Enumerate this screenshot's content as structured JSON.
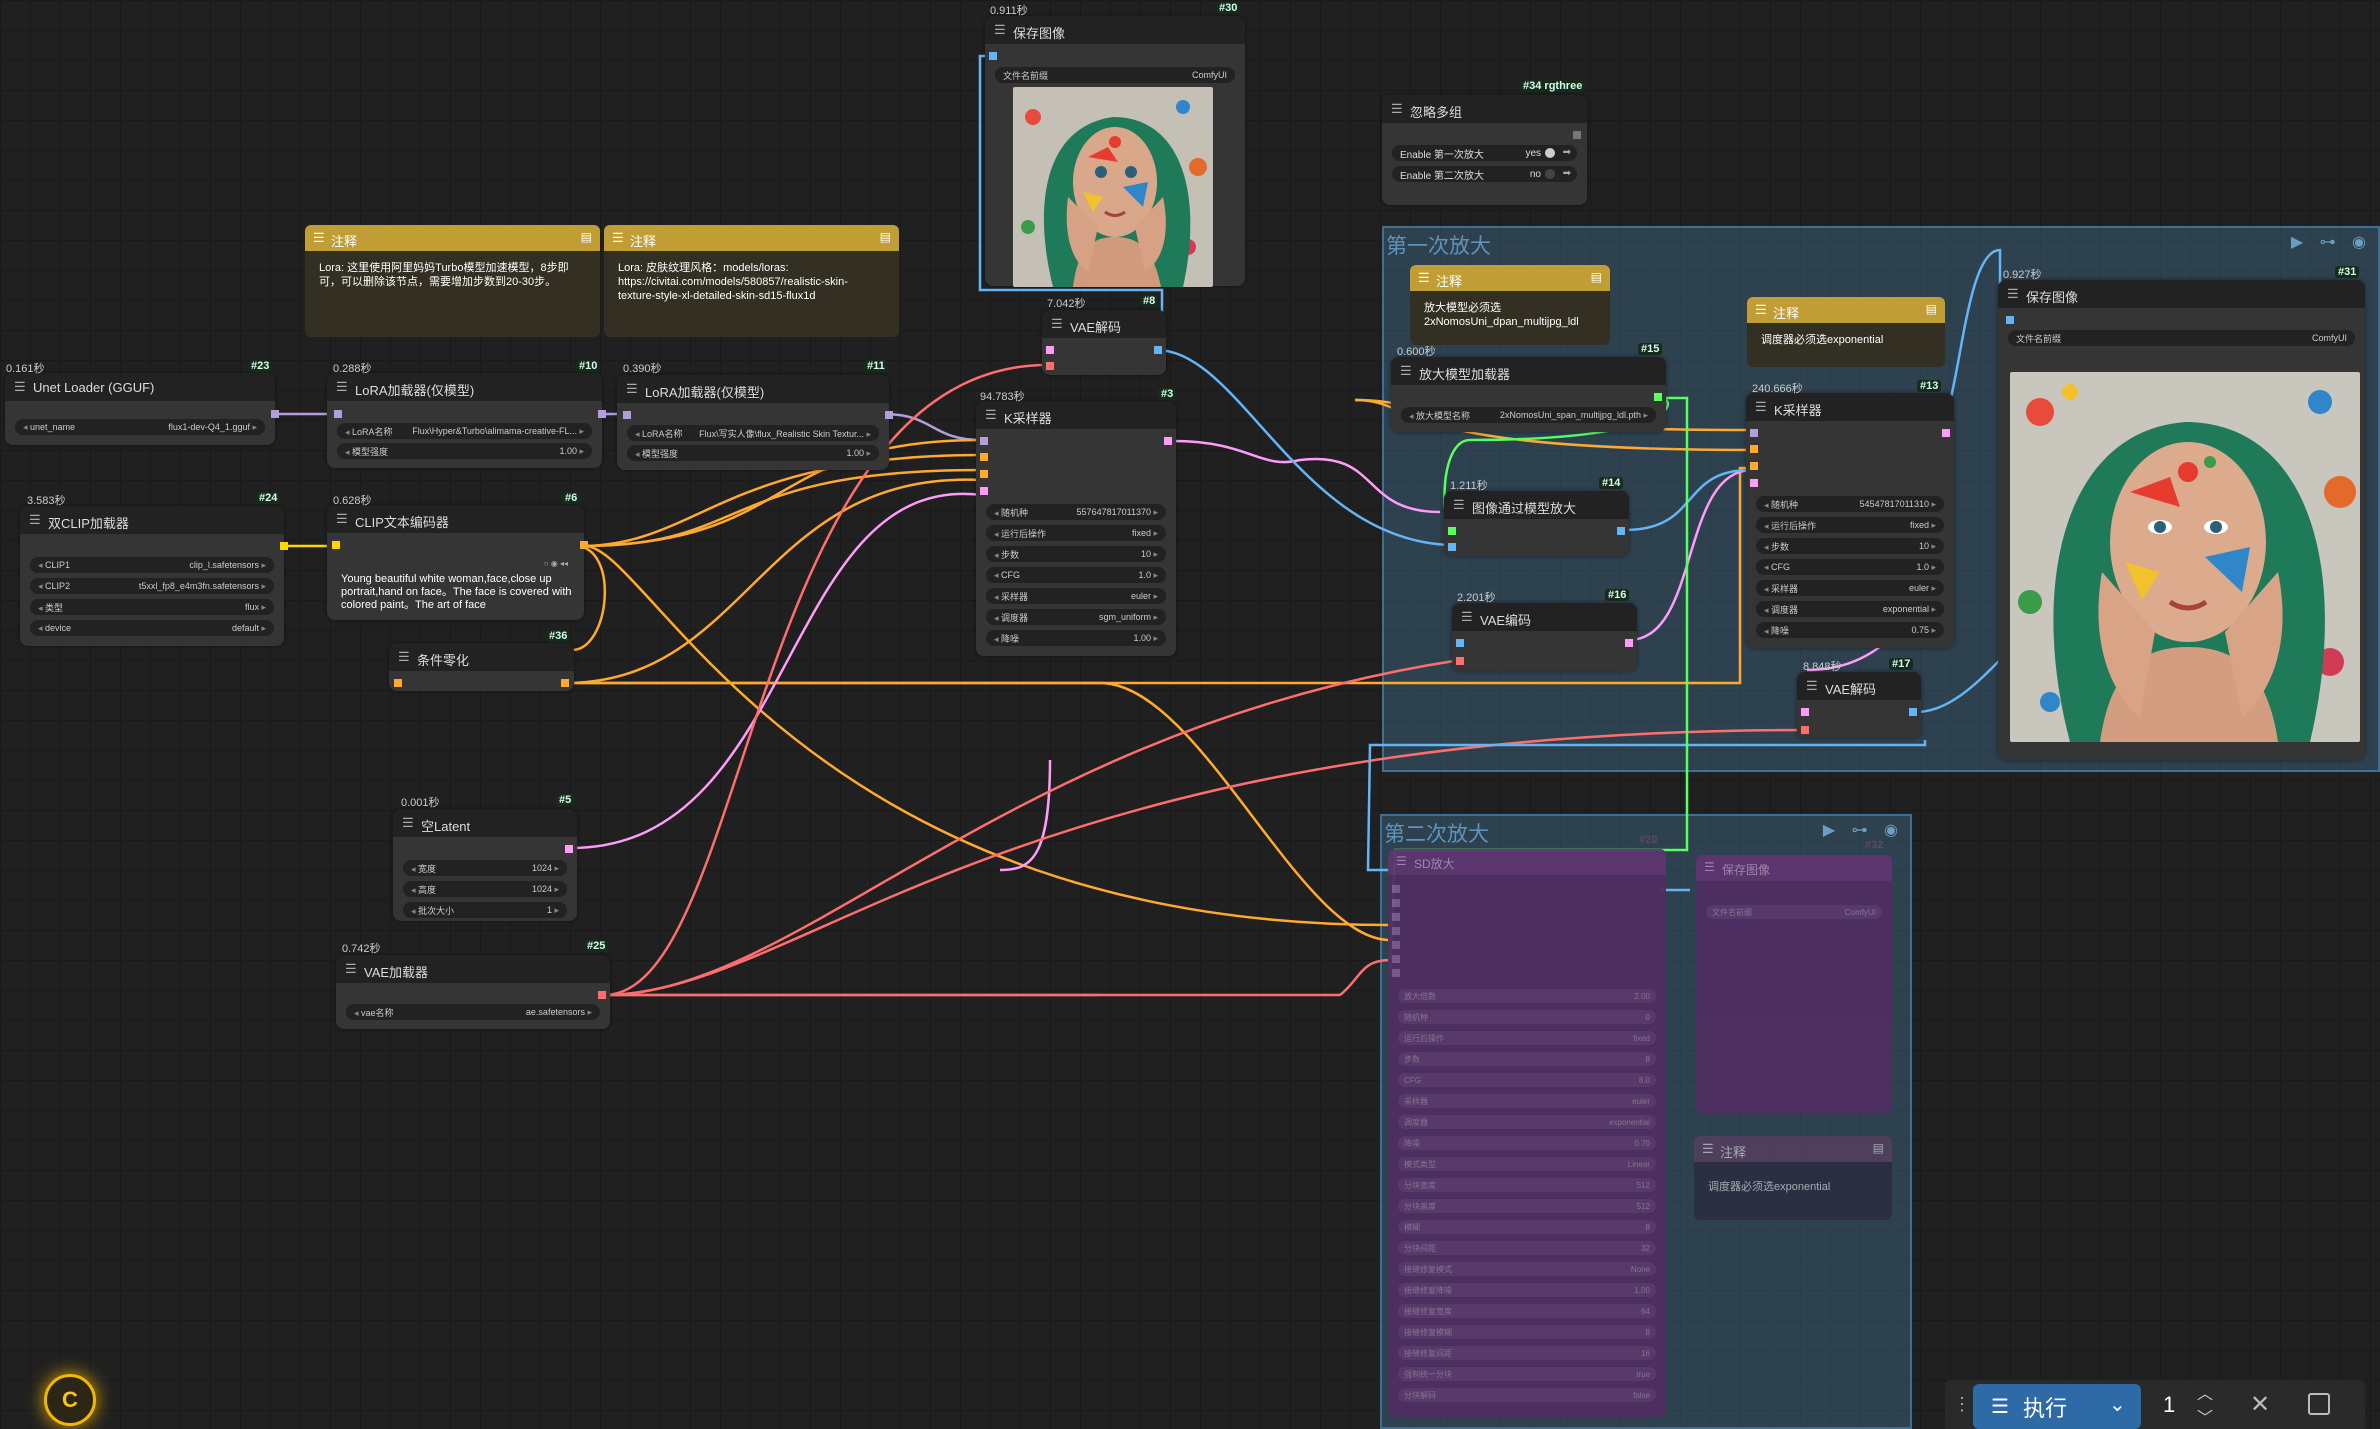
{
  "groups": {
    "g1": {
      "title": "第一次放大"
    },
    "g2": {
      "title": "第二次放大"
    }
  },
  "notes": {
    "n1": {
      "title": "注释",
      "text": "Lora: 这里使用阿里妈妈Turbo模型加速模型，8步即可，可以删除该节点，需要增加步数到20-30步。"
    },
    "n2": {
      "title": "注释",
      "text": "Lora: 皮肤纹理风格：models/loras:\nhttps://civitai.com/models/580857/realistic-skin-texture-style-xl-detailed-skin-sd15-flux1d"
    },
    "n3": {
      "title": "注释",
      "text": "放大模型必须选\n2xNomosUni_dpan_multijpg_ldl"
    },
    "n4": {
      "title": "注释",
      "text": "调度器必须选exponential"
    },
    "n5": {
      "title": "注释",
      "text": "调度器必须选exponential"
    }
  },
  "nodes": {
    "unet": {
      "title": "Unet Loader (GGUF)",
      "time": "0.161秒",
      "id": "#23",
      "widgets": [
        {
          "label": "unet_name",
          "value": "flux1-dev-Q4_1.gguf"
        }
      ]
    },
    "lora1": {
      "title": "LoRA加载器(仅模型)",
      "time": "0.288秒",
      "id": "#10",
      "widgets": [
        {
          "label": "LoRA名称",
          "value": "Flux\\Hyper&Turbo\\alimama-creative-FL..."
        },
        {
          "label": "模型强度",
          "value": "1.00"
        }
      ]
    },
    "lora2": {
      "title": "LoRA加载器(仅模型)",
      "time": "0.390秒",
      "id": "#11",
      "widgets": [
        {
          "label": "LoRA名称",
          "value": "Flux\\写实人像\\flux_Realistic Skin Textur..."
        },
        {
          "label": "模型强度",
          "value": "1.00"
        }
      ]
    },
    "dclip": {
      "title": "双CLIP加载器",
      "time": "3.583秒",
      "id": "#24",
      "widgets": [
        {
          "label": "CLIP1",
          "value": "clip_l.safetensors"
        },
        {
          "label": "CLIP2",
          "value": "t5xxl_fp8_e4m3fn.safetensors"
        },
        {
          "label": "类型",
          "value": "flux"
        },
        {
          "label": "device",
          "value": "default"
        }
      ]
    },
    "clipenc": {
      "title": "CLIP文本编码器",
      "time": "0.628秒",
      "id": "#6",
      "text": "Young beautiful white woman,face,close up portrait,hand on face。The face is covered with colored paint。The art of face"
    },
    "zero": {
      "title": "条件零化",
      "id": "#36"
    },
    "latent": {
      "title": "空Latent",
      "time": "0.001秒",
      "id": "#5",
      "widgets": [
        {
          "label": "宽度",
          "value": "1024"
        },
        {
          "label": "高度",
          "value": "1024"
        },
        {
          "label": "批次大小",
          "value": "1"
        }
      ]
    },
    "vaeload": {
      "title": "VAE加载器",
      "time": "0.742秒",
      "id": "#25",
      "widgets": [
        {
          "label": "vae名称",
          "value": "ae.safetensors"
        }
      ]
    },
    "save30": {
      "title": "保存图像",
      "time": "0.911秒",
      "id": "#30",
      "widgets": [
        {
          "label": "文件名前缀",
          "value": "ComfyUI"
        }
      ]
    },
    "vaed8": {
      "title": "VAE解码",
      "time": "7.042秒",
      "id": "#8"
    },
    "ks3": {
      "title": "K采样器",
      "time": "94.783秒",
      "id": "#3",
      "widgets": [
        {
          "label": "随机种",
          "value": "557647817011370"
        },
        {
          "label": "运行后操作",
          "value": "fixed"
        },
        {
          "label": "步数",
          "value": "10"
        },
        {
          "label": "CFG",
          "value": "1.0"
        },
        {
          "label": "采样器",
          "value": "euler"
        },
        {
          "label": "调度器",
          "value": "sgm_uniform"
        },
        {
          "label": "降噪",
          "value": "1.00"
        }
      ]
    },
    "bypass34": {
      "title": "忽略多组",
      "id": "#34 rgthree",
      "toggles": [
        {
          "label": "Enable 第一次放大",
          "value": "yes"
        },
        {
          "label": "Enable 第二次放大",
          "value": "no"
        }
      ]
    },
    "upload15": {
      "title": "放大模型加载器",
      "time": "0.600秒",
      "id": "#15",
      "widgets": [
        {
          "label": "放大模型名称",
          "value": "2xNomosUni_span_multijpg_ldl.pth"
        }
      ]
    },
    "upscale14": {
      "title": "图像通过模型放大",
      "time": "1.211秒",
      "id": "#14"
    },
    "vaee16": {
      "title": "VAE编码",
      "time": "2.201秒",
      "id": "#16"
    },
    "ks13": {
      "title": "K采样器",
      "time": "240.666秒",
      "id": "#13",
      "widgets": [
        {
          "label": "随机种",
          "value": "545478170113​10"
        },
        {
          "label": "运行后操作",
          "value": "fixed"
        },
        {
          "label": "步数",
          "value": "10"
        },
        {
          "label": "CFG",
          "value": "1.0"
        },
        {
          "label": "采样器",
          "value": "euler"
        },
        {
          "label": "调度器",
          "value": "exponential"
        },
        {
          "label": "降噪",
          "value": "0.75"
        }
      ]
    },
    "vaed17": {
      "title": "VAE解码",
      "time": "8.848秒",
      "id": "#17"
    },
    "save31": {
      "title": "保存图像",
      "time": "0.927秒",
      "id": "#31",
      "widgets": [
        {
          "label": "文件名前缀",
          "value": "ComfyUI"
        }
      ]
    },
    "sd20": {
      "title": "SD放大",
      "id": "#20",
      "widgets": [
        {
          "label": "放大倍数",
          "value": "2.00"
        },
        {
          "label": "随机种",
          "value": "0"
        },
        {
          "label": "运行后操作",
          "value": "fixed"
        },
        {
          "label": "步数",
          "value": "8"
        },
        {
          "label": "CFG",
          "value": "8.0"
        },
        {
          "label": "采样器",
          "value": "euler"
        },
        {
          "label": "调度器",
          "value": "exponential"
        },
        {
          "label": "降噪",
          "value": "0.70"
        },
        {
          "label": "模式类型",
          "value": "Linear"
        },
        {
          "label": "分块宽度",
          "value": "512"
        },
        {
          "label": "分块高度",
          "value": "512"
        },
        {
          "label": "模糊",
          "value": "8"
        },
        {
          "label": "分块间距",
          "value": "32"
        },
        {
          "label": "接缝修复模式",
          "value": "None"
        },
        {
          "label": "接缝修复降噪",
          "value": "1.00"
        },
        {
          "label": "接缝修复宽度",
          "value": "64"
        },
        {
          "label": "接缝修复模糊",
          "value": "8"
        },
        {
          "label": "接缝修复间距",
          "value": "16"
        },
        {
          "label": "强制统一分块",
          "value": "true"
        },
        {
          "label": "分块解码",
          "value": "false"
        }
      ]
    },
    "save32": {
      "title": "保存图像",
      "id": "#32",
      "widgets": [
        {
          "label": "文件名前缀",
          "value": "ComfyUI"
        }
      ]
    }
  },
  "toolbar": {
    "run_label": "执行",
    "batch_count": "1"
  },
  "logo": {
    "letter": "C"
  },
  "colors": {
    "model": "#b39ddb",
    "clip": "#ffd500",
    "conditioning": "#ffa931",
    "latent": "#ff9cf9",
    "vae": "#ff6e6e",
    "image": "#64b5f6",
    "upscale_model": "#58ff60",
    "accent": "#2d6aa6"
  }
}
